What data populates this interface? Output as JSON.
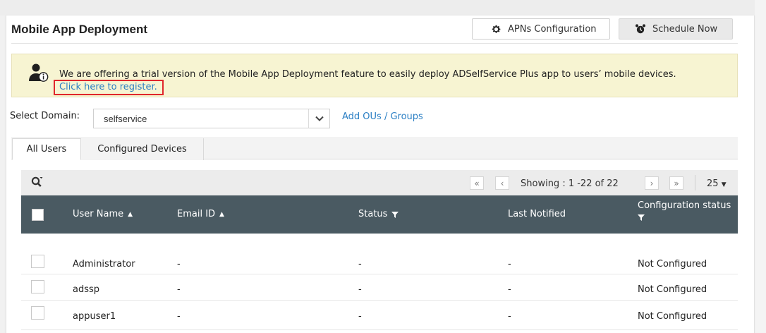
{
  "page": {
    "title": "Mobile App Deployment"
  },
  "header_buttons": {
    "apns_label": "APNs Configuration",
    "schedule_label": "Schedule Now"
  },
  "banner": {
    "message": "We are offering a trial version of the Mobile App Deployment feature to easily deploy ADSelfService Plus app to users’ mobile devices.",
    "register_link": "Click here to register."
  },
  "domain": {
    "label": "Select Domain:",
    "selected": "selfservice",
    "add_link": "Add OUs / Groups"
  },
  "tabs": [
    {
      "label": "All Users",
      "active": true
    },
    {
      "label": "Configured Devices",
      "active": false
    }
  ],
  "toolbar": {
    "showing": "Showing :  1 -22 of 22",
    "per_page": "25"
  },
  "table": {
    "columns": [
      {
        "label": "User Name",
        "indicator": "sort-asc"
      },
      {
        "label": "Email ID",
        "indicator": "sort-asc"
      },
      {
        "label": "Status",
        "indicator": "filter"
      },
      {
        "label": "Last Notified",
        "indicator": "none"
      },
      {
        "label": "Configuration status",
        "indicator": "filter"
      }
    ],
    "rows": [
      {
        "user": "Administrator",
        "email": "-",
        "status": "-",
        "last": "-",
        "config": "Not Configured"
      },
      {
        "user": "adssp",
        "email": "-",
        "status": "-",
        "last": "-",
        "config": "Not Configured"
      },
      {
        "user": "appuser1",
        "email": "-",
        "status": "-",
        "last": "-",
        "config": "Not Configured"
      }
    ]
  },
  "colors": {
    "header_bg": "#4a5a62",
    "banner_bg": "#f7f4d2",
    "link": "#2b7fc4",
    "highlight_border": "#e0262c"
  }
}
